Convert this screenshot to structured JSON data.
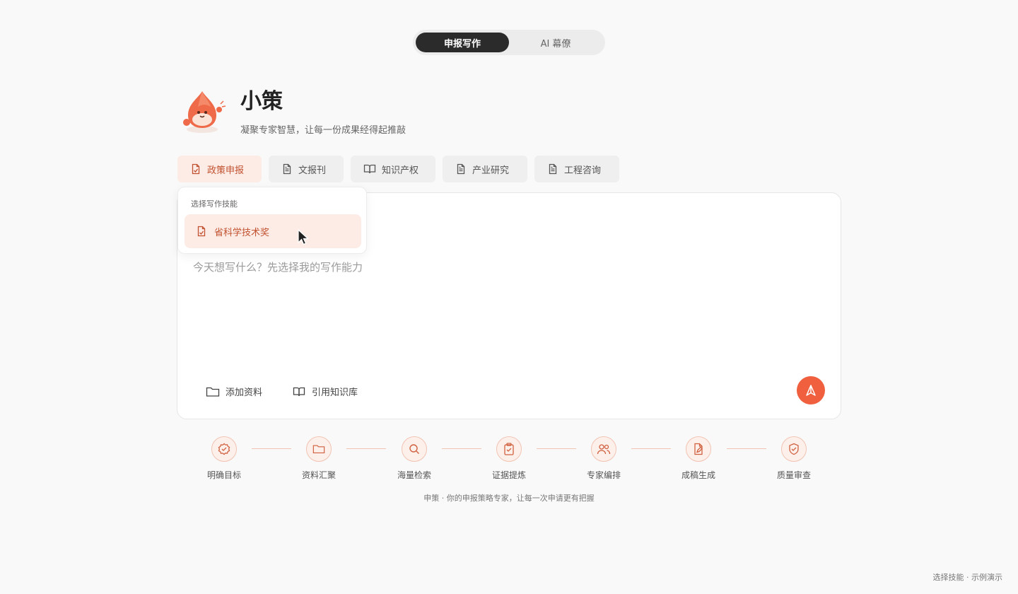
{
  "mode_toggle": {
    "options": [
      "申报写作",
      "AI 幕僚"
    ],
    "active": "申报写作"
  },
  "header": {
    "title": "小策",
    "subtitle": "凝聚专家智慧，让每一份成果经得起推敲"
  },
  "tabs": [
    {
      "label": "政策申报",
      "icon": "document-check-icon",
      "active": true
    },
    {
      "label": "文报刊",
      "icon": "document-icon",
      "active": false
    },
    {
      "label": "知识产权",
      "icon": "book-open-icon",
      "active": false
    },
    {
      "label": "产业研究",
      "icon": "document-icon",
      "active": false
    },
    {
      "label": "工程咨询",
      "icon": "document-icon",
      "active": false
    }
  ],
  "dropdown": {
    "header": "选择写作技能",
    "items": [
      {
        "label": "省科学技术奖",
        "icon": "document-check-icon"
      }
    ]
  },
  "composer": {
    "placeholder": "今天想写什么？先选择我的写作能力",
    "actions": [
      {
        "label": "添加资料",
        "icon": "folder-icon"
      },
      {
        "label": "引用知识库",
        "icon": "book-open-icon"
      }
    ],
    "send_icon": "send-icon"
  },
  "steps": [
    {
      "label": "明确目标",
      "icon": "badge-check-icon"
    },
    {
      "label": "资料汇聚",
      "icon": "folder-icon"
    },
    {
      "label": "海量检索",
      "icon": "search-icon"
    },
    {
      "label": "证据提炼",
      "icon": "clipboard-check-icon"
    },
    {
      "label": "专家编排",
      "icon": "users-icon"
    },
    {
      "label": "成稿生成",
      "icon": "file-edit-icon"
    },
    {
      "label": "质量审查",
      "icon": "shield-check-icon"
    }
  ],
  "tagline": "申策 · 你的申报策略专家，让每一次申请更有把握",
  "footer_note": "选择技能 · 示例演示",
  "colors": {
    "accent": "#f0603f",
    "accent_text": "#c1512f",
    "accent_bg": "#fdece6",
    "dark": "#2b2b2b"
  }
}
